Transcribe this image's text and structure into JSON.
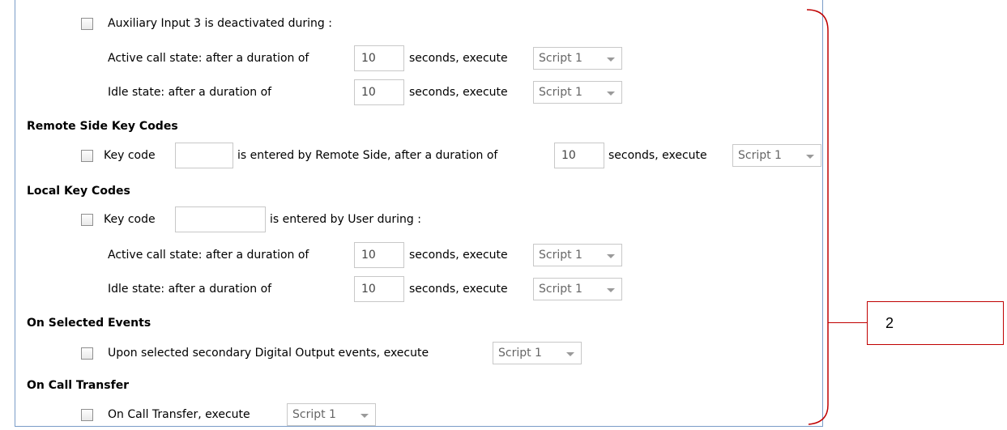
{
  "aux3": {
    "checkbox_label": "Auxiliary Input 3 is deactivated during :",
    "active_label": "Active call state: after a duration of",
    "active_seconds": "10",
    "idle_label": "Idle state: after a duration of",
    "idle_seconds": "10",
    "seconds_execute": "seconds, execute",
    "active_script": "Script 1",
    "idle_script": "Script 1"
  },
  "remote_keys": {
    "heading": "Remote Side Key Codes",
    "key_code_label": "Key code",
    "key_code_value": "",
    "entered_label": "is entered by Remote Side, after a duration of",
    "seconds": "10",
    "seconds_execute": "seconds, execute",
    "script": "Script 1"
  },
  "local_keys": {
    "heading": "Local Key Codes",
    "key_code_label": "Key code",
    "key_code_value": "",
    "entered_label": "is entered by User during :",
    "active_label": "Active call state: after a duration of",
    "active_seconds": "10",
    "idle_label": "Idle state: after a duration of",
    "idle_seconds": "10",
    "seconds_execute": "seconds, execute",
    "active_script": "Script 1",
    "idle_script": "Script 1"
  },
  "selected_events": {
    "heading": "On Selected Events",
    "label": "Upon selected secondary Digital Output events, execute",
    "script": "Script 1"
  },
  "call_transfer": {
    "heading": "On Call Transfer",
    "label": "On Call Transfer, execute",
    "script": "Script 1"
  },
  "annotation": {
    "label": "2",
    "color": "#c00000"
  }
}
